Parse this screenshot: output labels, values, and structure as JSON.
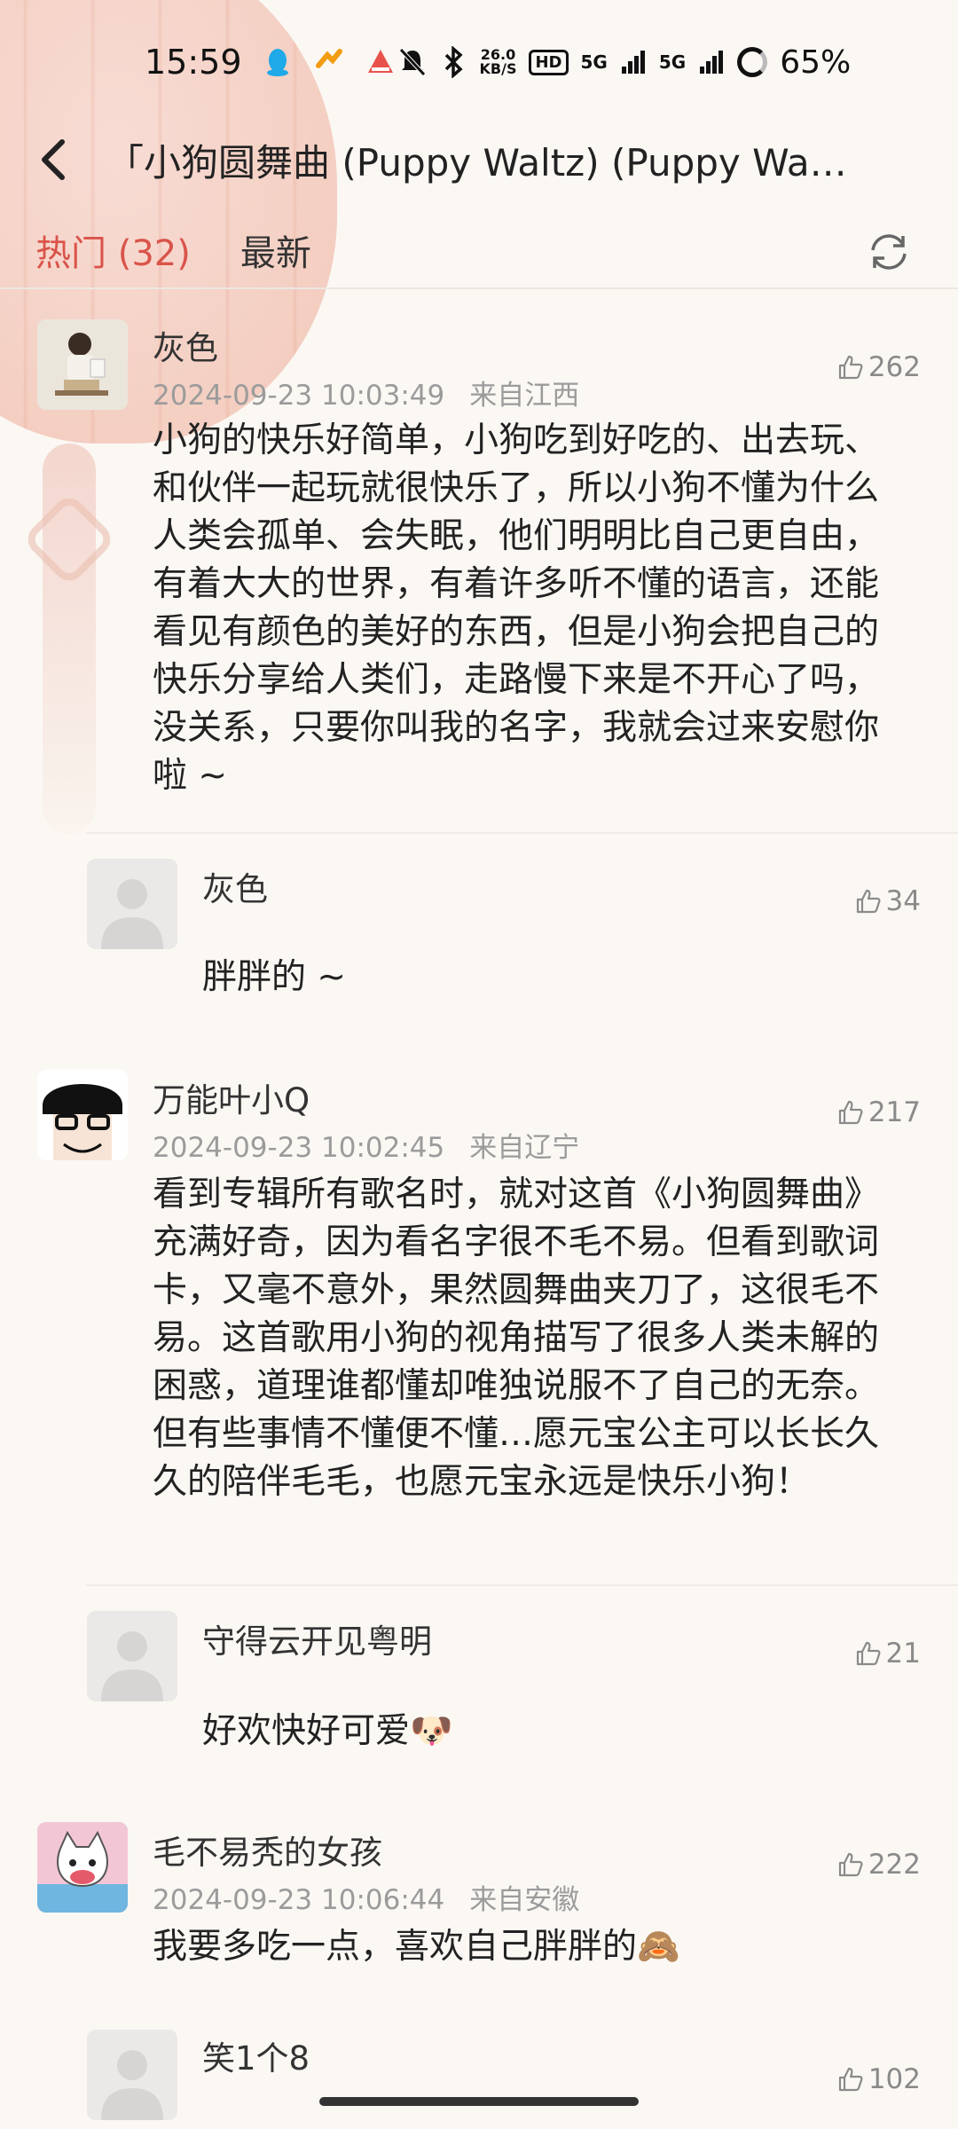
{
  "status": {
    "time": "15:59",
    "net_speed_top": "26.0",
    "net_speed_bottom": "KB/S",
    "hd": "HD",
    "sig1": "5G",
    "sig2": "5G",
    "battery": "65%"
  },
  "header": {
    "title": "「小狗圆舞曲 (Puppy Waltz) (Puppy Walt…"
  },
  "tabs": {
    "hot": "热门 (32)",
    "latest": "最新"
  },
  "comments": [
    {
      "username": "灰色",
      "date": "2024-09-23 10:03:49",
      "location": "来自江西",
      "likes": "262",
      "content": "小狗的快乐好简单，小狗吃到好吃的、出去玩、和伙伴一起玩就很快乐了，所以小狗不懂为什么人类会孤单、会失眠，他们明明比自己更自由，有着大大的世界，有着许多听不懂的语言，还能看见有颜色的美好的东西，但是小狗会把自己的快乐分享给人类们，走路慢下来是不开心了吗，没关系，只要你叫我的名字，我就会过来安慰你啦 ~",
      "reply": {
        "username": "灰色",
        "likes": "34",
        "content": "胖胖的 ~"
      }
    },
    {
      "username": "万能叶小Q",
      "date": "2024-09-23 10:02:45",
      "location": "来自辽宁",
      "likes": "217",
      "content": "看到专辑所有歌名时，就对这首《小狗圆舞曲》充满好奇，因为看名字很不毛不易。但看到歌词卡，又毫不意外，果然圆舞曲夹刀了，这很毛不易。这首歌用小狗的视角描写了很多人类未解的困惑，道理谁都懂却唯独说服不了自己的无奈。但有些事情不懂便不懂…愿元宝公主可以长长久久的陪伴毛毛，也愿元宝永远是快乐小狗！",
      "reply": {
        "username": "守得云开见粤明",
        "likes": "21",
        "content": "好欢快好可爱🐶"
      }
    },
    {
      "username": "毛不易秃的女孩",
      "date": "2024-09-23 10:06:44",
      "location": "来自安徽",
      "likes": "222",
      "content": "我要多吃一点，喜欢自己胖胖的🙈",
      "reply": {
        "username": "笑1个8",
        "likes": "102",
        "content": ""
      }
    }
  ],
  "colors": {
    "accent": "#d9544a",
    "meta": "#9b9b9b",
    "background": "#fbf8f4"
  },
  "icons": [
    "back-arrow-icon",
    "refresh-icon",
    "thumbs-up-icon",
    "default-avatar-icon"
  ]
}
